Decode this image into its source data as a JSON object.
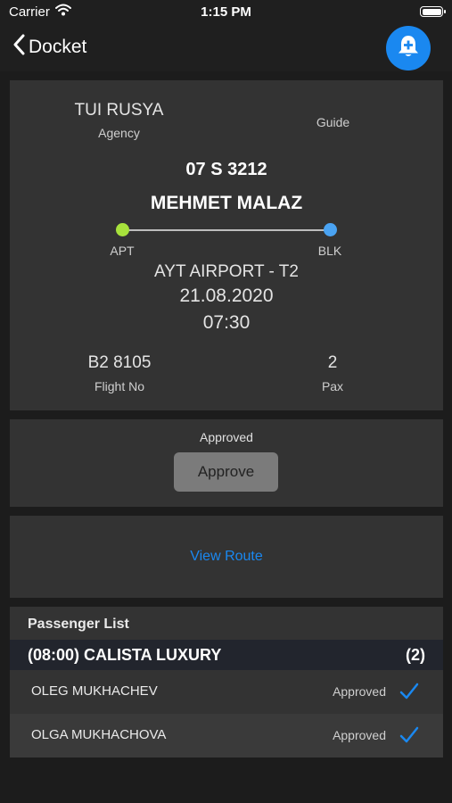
{
  "status_bar": {
    "carrier": "Carrier",
    "time": "1:15 PM"
  },
  "nav": {
    "back_label": "Docket",
    "bell_icon": "bell-plus-icon"
  },
  "docket": {
    "agency": "TUI RUSYA",
    "agency_label": "Agency",
    "guide_label": "Guide",
    "plate": "07 S 3212",
    "driver": "MEHMET MALAZ",
    "route_from": "APT",
    "route_to": "BLK",
    "location": "AYT AIRPORT - T2",
    "date": "21.08.2020",
    "time": "07:30",
    "flight_no": "B2 8105",
    "flight_no_label": "Flight No",
    "pax": "2",
    "pax_label": "Pax"
  },
  "approval": {
    "status": "Approved",
    "button_label": "Approve"
  },
  "route": {
    "view_route_label": "View Route"
  },
  "passenger_list": {
    "title": "Passenger List",
    "hotel": {
      "name": "(08:00) CALISTA LUXURY",
      "count": "(2)"
    },
    "passengers": [
      {
        "name": "OLEG MUKHACHEV",
        "status": "Approved"
      },
      {
        "name": "OLGA MUKHACHOVA",
        "status": "Approved"
      }
    ]
  },
  "colors": {
    "accent": "#1a88f0",
    "route_start": "#a7e23c",
    "route_end": "#4aa3f2",
    "card": "#333333",
    "background": "#1c1c1c"
  }
}
